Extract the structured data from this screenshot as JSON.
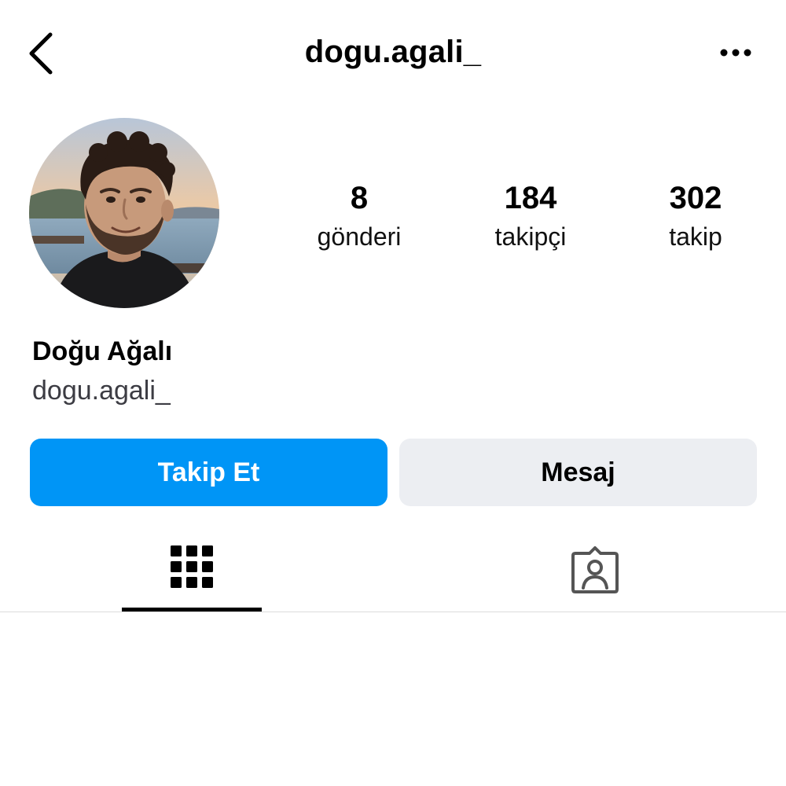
{
  "header": {
    "title": "dogu.agali_",
    "back_icon": "chevron-left-icon",
    "more_icon": "more-horizontal-icon"
  },
  "profile": {
    "avatar": "profile-photo",
    "name": "Doğu Ağalı",
    "handle": "dogu.agali_"
  },
  "stats": [
    {
      "value": "8",
      "label": "gönderi"
    },
    {
      "value": "184",
      "label": "takipçi"
    },
    {
      "value": "302",
      "label": "takip"
    }
  ],
  "actions": {
    "follow_label": "Takip Et",
    "message_label": "Mesaj"
  },
  "tabs": [
    {
      "icon": "grid-icon",
      "active": true
    },
    {
      "icon": "tagged-icon",
      "active": false
    }
  ],
  "colors": {
    "accent": "#0095f6",
    "secondary_button": "#eceef2",
    "divider": "#dbdbdb"
  }
}
